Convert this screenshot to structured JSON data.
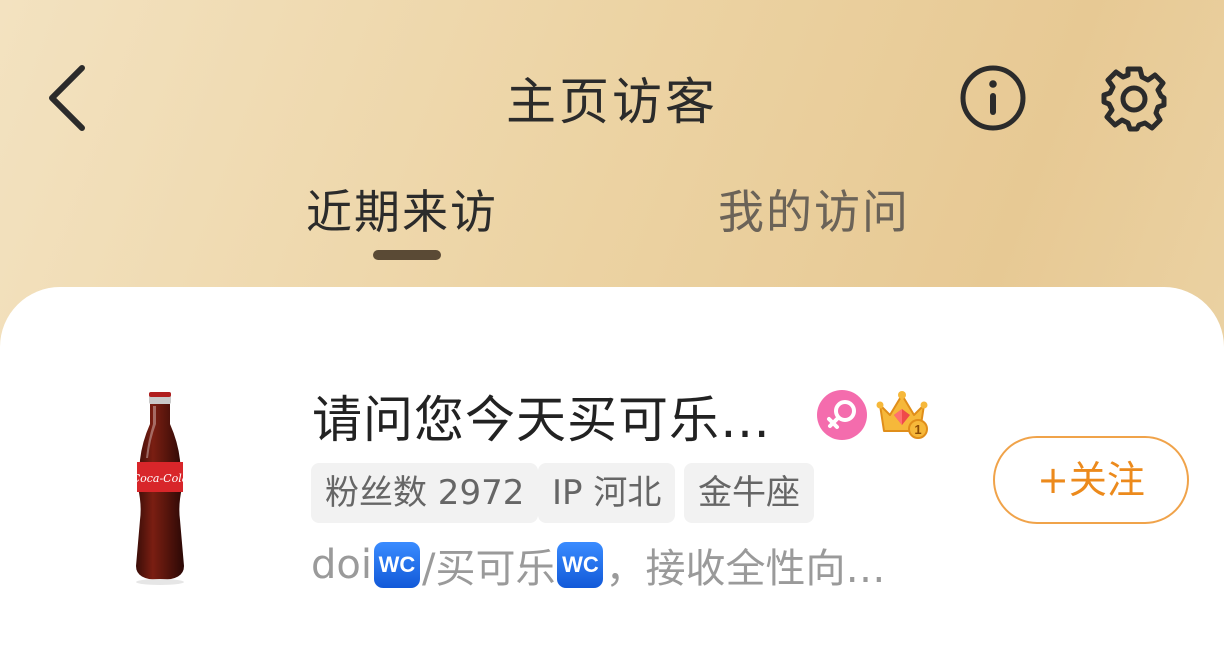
{
  "header": {
    "title": "主页访客",
    "back_icon": "chevron-left-icon",
    "info_icon": "info-icon",
    "settings_icon": "gear-icon"
  },
  "tabs": [
    {
      "label": "近期来访",
      "active": true
    },
    {
      "label": "我的访问",
      "active": false
    }
  ],
  "visitor": {
    "name": "请问您今天买可乐…",
    "avatar": "coca-cola-bottle-image",
    "gender_icon": "female-icon",
    "vip_icon": "crown-icon",
    "vip_level": "1",
    "tags": {
      "fans": "粉丝数 2972",
      "ip": "IP 河北",
      "zodiac": "金牛座"
    },
    "bio": {
      "part1": "doi",
      "wc1": "WC",
      "part2": "/买可乐",
      "wc2": "WC",
      "part3": "，接收全性向…"
    },
    "follow_label": "+关注"
  },
  "colors": {
    "accent": "#ec8a1c",
    "gender_badge": "#f46cad",
    "wc_badge": "#1f6ef0"
  }
}
